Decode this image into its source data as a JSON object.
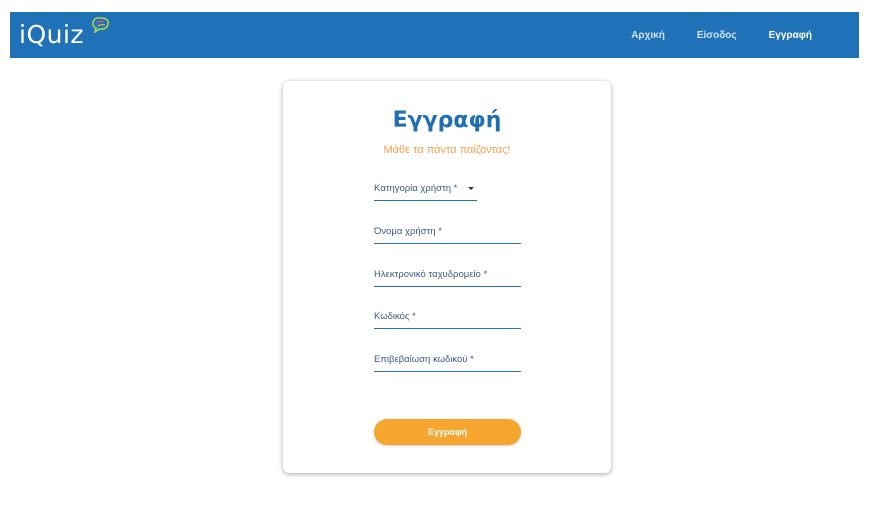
{
  "brand": {
    "name": "iQuiz"
  },
  "nav": {
    "items": [
      {
        "label": "Αρχική",
        "active": false
      },
      {
        "label": "Είσοδος",
        "active": false
      },
      {
        "label": "Εγγραφή",
        "active": true
      }
    ]
  },
  "form": {
    "title": "Εγγραφή",
    "subtitle": "Μάθε τα πάντα παίζοντας!",
    "fields": [
      {
        "label": "Κατηγορία χρήστη *",
        "type": "select"
      },
      {
        "label": "Όνομα χρήστη *",
        "type": "text"
      },
      {
        "label": "Ηλεκτρονικό ταχυδρομείο *",
        "type": "email"
      },
      {
        "label": "Κωδικός *",
        "type": "password"
      },
      {
        "label": "Επιβεβαίωση κωδικού *",
        "type": "password"
      }
    ],
    "submit_label": "Εγγραφή"
  },
  "colors": {
    "navbar": "#1f72b8",
    "title": "#1f6fb2",
    "subtitle": "#f0a14a",
    "button": "#f6a52e"
  }
}
